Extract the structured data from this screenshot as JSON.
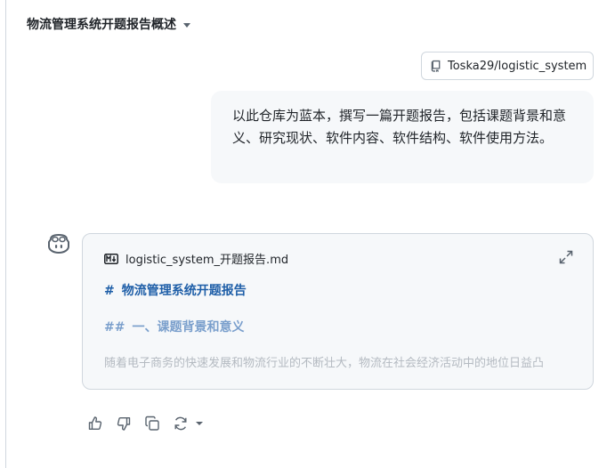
{
  "conversation": {
    "title": "物流管理系统开题报告概述"
  },
  "repo_reference": {
    "label": "Toska29/logistic_system"
  },
  "user_message": {
    "text": "以此仓库为蓝本，撰写一篇开题报告，包括课题背景和意义、研究现状、软件内容、软件结构、软件使用方法。"
  },
  "artifact": {
    "filename": "logistic_system_开题报告.md",
    "h1_marker": "#",
    "h1_text": "物流管理系统开题报告",
    "h2_marker": "##",
    "h2_text": "一、课题背景和意义",
    "preview_text": "随着电子商务的快速发展和物流行业的不断壮大，物流在社会经济活动中的地位日益凸"
  },
  "icons": {
    "repo": "repo-icon",
    "assistant": "copilot-avatar-icon",
    "markdown": "markdown-icon",
    "expand": "expand-icon",
    "thumbs_up": "thumbs-up-icon",
    "thumbs_down": "thumbs-down-icon",
    "copy": "copy-icon",
    "retry": "retry-icon"
  }
}
